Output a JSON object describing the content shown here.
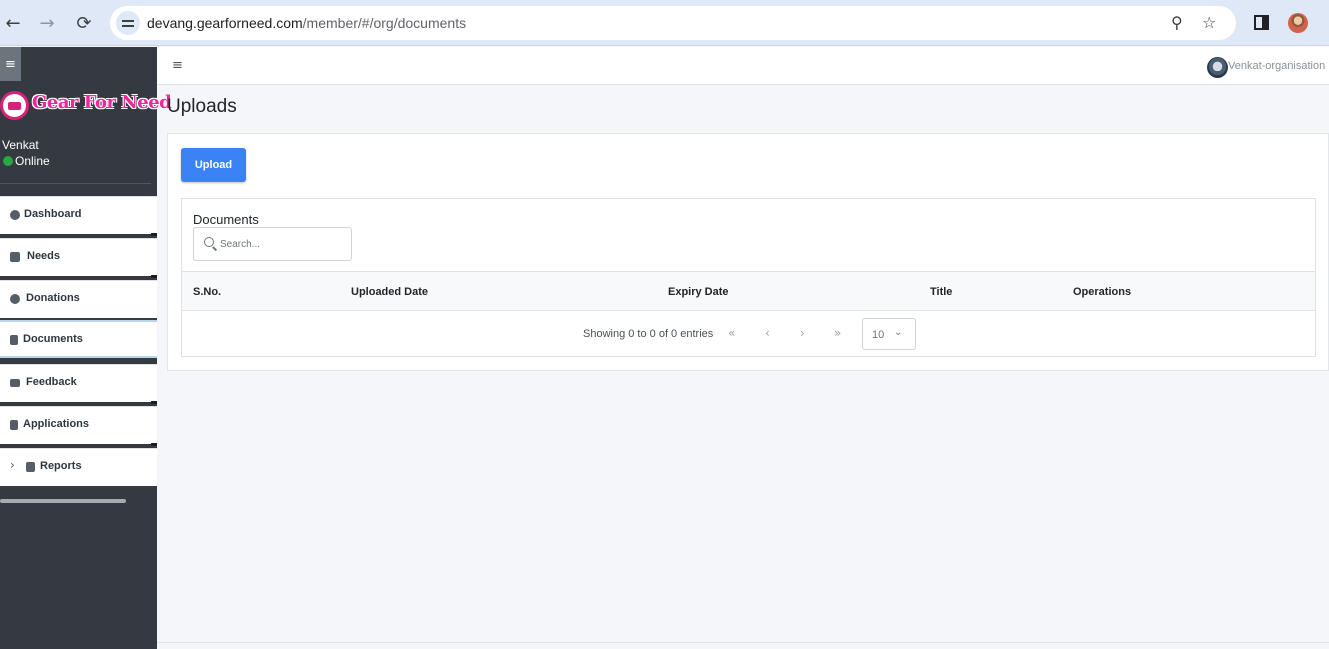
{
  "browser": {
    "url_host": "devang.gearforneed.com",
    "url_path": "/member/#/org/documents",
    "back_icon": "←",
    "forward_icon": "→",
    "reload_icon": "⟳",
    "zoom_icon": "⚲",
    "star_icon": "☆"
  },
  "sidebar": {
    "toggle_icon": "≡",
    "brand": "Gear For Need",
    "user": {
      "name": "Venkat",
      "status": "Online"
    },
    "items": [
      {
        "label": "Dashboard",
        "icon": "dashboard-icon"
      },
      {
        "label": "Needs",
        "icon": "hand-heart-icon"
      },
      {
        "label": "Donations",
        "icon": "donation-icon"
      },
      {
        "label": "Documents",
        "icon": "document-icon"
      },
      {
        "label": "Feedback",
        "icon": "envelope-icon"
      },
      {
        "label": "Applications",
        "icon": "document-icon"
      },
      {
        "label": "Reports",
        "icon": "copy-icon",
        "chevron": "›"
      }
    ]
  },
  "topbar": {
    "hamburger_icon": "≡",
    "org_name": "Venkat-organisation"
  },
  "page": {
    "title": "Uploads",
    "upload_label": "Upload"
  },
  "documents": {
    "title": "Documents",
    "search_placeholder": "Search...",
    "columns": [
      "S.No.",
      "Uploaded Date",
      "Expiry Date",
      "Title",
      "Operations"
    ],
    "rows": [],
    "paging": {
      "info": "Showing 0 to 0 of 0 entries",
      "first": "«",
      "prev": "‹",
      "next": "›",
      "last": "»",
      "rows_per_page": "10",
      "dropdown_icon": "⌄"
    }
  },
  "colors": {
    "sidebar_bg": "#343a40",
    "primary_button": "#3b82f6",
    "online": "#28a745",
    "brand_pink": "#f2259b"
  }
}
